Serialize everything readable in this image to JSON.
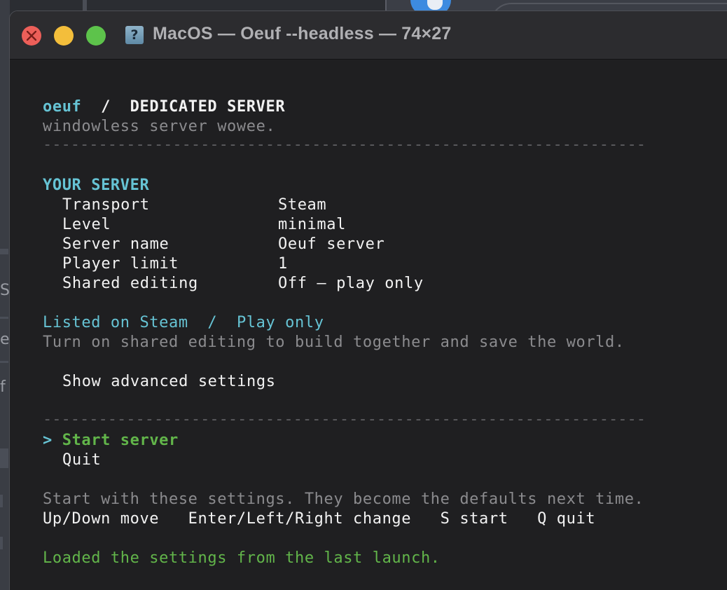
{
  "window": {
    "title": "MacOS — Oeuf --headless — 74×27",
    "title_icon_glyph": "?"
  },
  "header": {
    "app": "oeuf",
    "separator": "/",
    "section": "DEDICATED SERVER",
    "tagline": "windowless server wowee."
  },
  "rule": "-----------------------------------------------------------------",
  "server": {
    "heading": "YOUR SERVER",
    "rows": [
      {
        "label": "Transport",
        "value": "Steam"
      },
      {
        "label": "Level",
        "value": "minimal"
      },
      {
        "label": "Server name",
        "value": "Oeuf server"
      },
      {
        "label": "Player limit",
        "value": "1"
      },
      {
        "label": "Shared editing",
        "value": "Off — play only"
      }
    ]
  },
  "status": {
    "listed": "Listed on Steam",
    "separator": "/",
    "mode": "Play only",
    "hint": "Turn on shared editing to build together and save the world."
  },
  "advanced": {
    "label": "Show advanced settings"
  },
  "menu": {
    "cursor": ">",
    "items": [
      {
        "label": "Start server",
        "selected": true
      },
      {
        "label": "Quit",
        "selected": false
      }
    ]
  },
  "help": {
    "description": "Start with these settings. They become the defaults next time.",
    "keys": "Up/Down move   Enter/Left/Right change   S start   Q quit"
  },
  "message": "Loaded the settings from the last launch.",
  "colors": {
    "accent_cyan": "#66c3d4",
    "accent_green": "#62b54a",
    "text_white": "#f2f2f2",
    "text_gray": "#8b8b8e",
    "terminal_bg": "#1f1f21"
  },
  "background": {
    "left_fragments": [
      "S",
      "e",
      "f"
    ]
  }
}
